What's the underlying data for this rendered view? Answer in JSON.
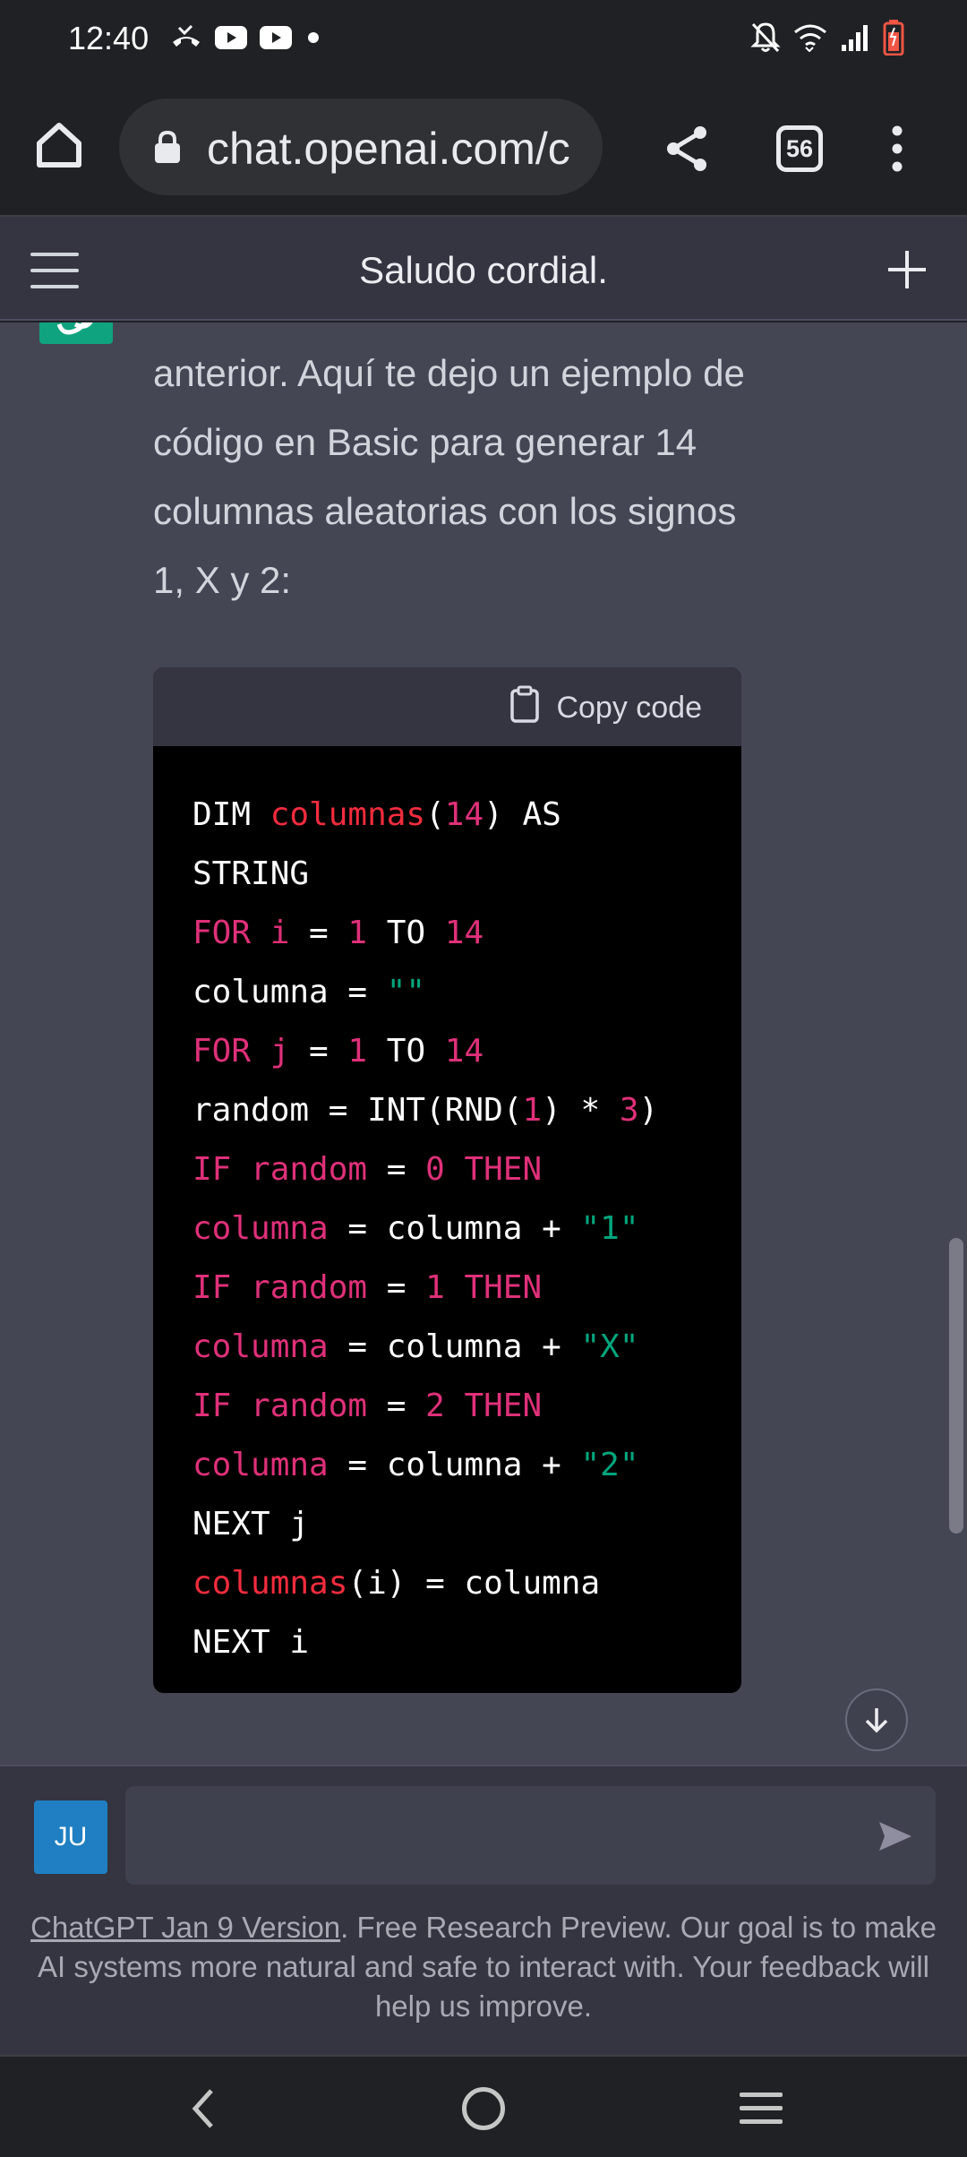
{
  "status_bar": {
    "time": "12:40",
    "left_icons": [
      "missed-call-icon",
      "youtube-icon",
      "youtube-icon",
      "dot-icon"
    ],
    "right_icons": [
      "mute-icon",
      "wifi-icon",
      "signal-icon",
      "battery-icon"
    ]
  },
  "browser": {
    "url": "chat.openai.com/c",
    "tab_count": "56"
  },
  "chat": {
    "title": "Saludo cordial.",
    "message_text": "anterior. Aquí te dejo un ejemplo de código en Basic para generar 14 columnas aleatorias con los signos 1, X y 2:",
    "copy_label": "Copy code"
  },
  "code_lines": [
    [
      {
        "t": "DIM ",
        "c": ""
      },
      {
        "t": "columnas",
        "c": "fn"
      },
      {
        "t": "(",
        "c": ""
      },
      {
        "t": "14",
        "c": "num"
      },
      {
        "t": ") AS",
        "c": ""
      }
    ],
    [
      {
        "t": "STRING",
        "c": ""
      }
    ],
    [
      {
        "t": "FOR i",
        "c": "kw"
      },
      {
        "t": " = ",
        "c": ""
      },
      {
        "t": "1",
        "c": "num"
      },
      {
        "t": " TO ",
        "c": ""
      },
      {
        "t": "14",
        "c": "num"
      }
    ],
    [
      {
        "t": "columna = ",
        "c": ""
      },
      {
        "t": "\"\"",
        "c": "str"
      }
    ],
    [
      {
        "t": "FOR j",
        "c": "kw"
      },
      {
        "t": " = ",
        "c": ""
      },
      {
        "t": "1",
        "c": "num"
      },
      {
        "t": " TO ",
        "c": ""
      },
      {
        "t": "14",
        "c": "num"
      }
    ],
    [
      {
        "t": "random = INT(RND(",
        "c": ""
      },
      {
        "t": "1",
        "c": "num"
      },
      {
        "t": ") * ",
        "c": ""
      },
      {
        "t": "3",
        "c": "num"
      },
      {
        "t": ")",
        "c": ""
      }
    ],
    [
      {
        "t": "IF random",
        "c": "kw"
      },
      {
        "t": " = ",
        "c": ""
      },
      {
        "t": "0 THEN",
        "c": "kw"
      }
    ],
    [
      {
        "t": "columna",
        "c": "kw"
      },
      {
        "t": " = columna + ",
        "c": ""
      },
      {
        "t": "\"1\"",
        "c": "str"
      }
    ],
    [
      {
        "t": "IF random",
        "c": "kw"
      },
      {
        "t": " = ",
        "c": ""
      },
      {
        "t": "1 THEN",
        "c": "kw"
      }
    ],
    [
      {
        "t": "columna",
        "c": "kw"
      },
      {
        "t": " = columna + ",
        "c": ""
      },
      {
        "t": "\"X\"",
        "c": "str"
      }
    ],
    [
      {
        "t": "IF random",
        "c": "kw"
      },
      {
        "t": " = ",
        "c": ""
      },
      {
        "t": "2 THEN",
        "c": "kw"
      }
    ],
    [
      {
        "t": "columna",
        "c": "kw"
      },
      {
        "t": " = columna + ",
        "c": ""
      },
      {
        "t": "\"2\"",
        "c": "str"
      }
    ],
    [
      {
        "t": "NEXT j",
        "c": ""
      }
    ],
    [
      {
        "t": "columnas",
        "c": "fn"
      },
      {
        "t": "(i) = columna",
        "c": ""
      }
    ],
    [
      {
        "t": "NEXT i",
        "c": ""
      }
    ]
  ],
  "input": {
    "user_initials": "JU",
    "placeholder": ""
  },
  "footer": {
    "version_link": "ChatGPT Jan 9 Version",
    "disclaimer": ". Free Research Preview. Our goal is to make AI systems more natural and safe to interact with. Your feedback will help us improve."
  },
  "colors": {
    "accent": "#10a37f",
    "keyword": "#df3079",
    "string": "#00a67d",
    "identifier": "#f22c3d"
  }
}
